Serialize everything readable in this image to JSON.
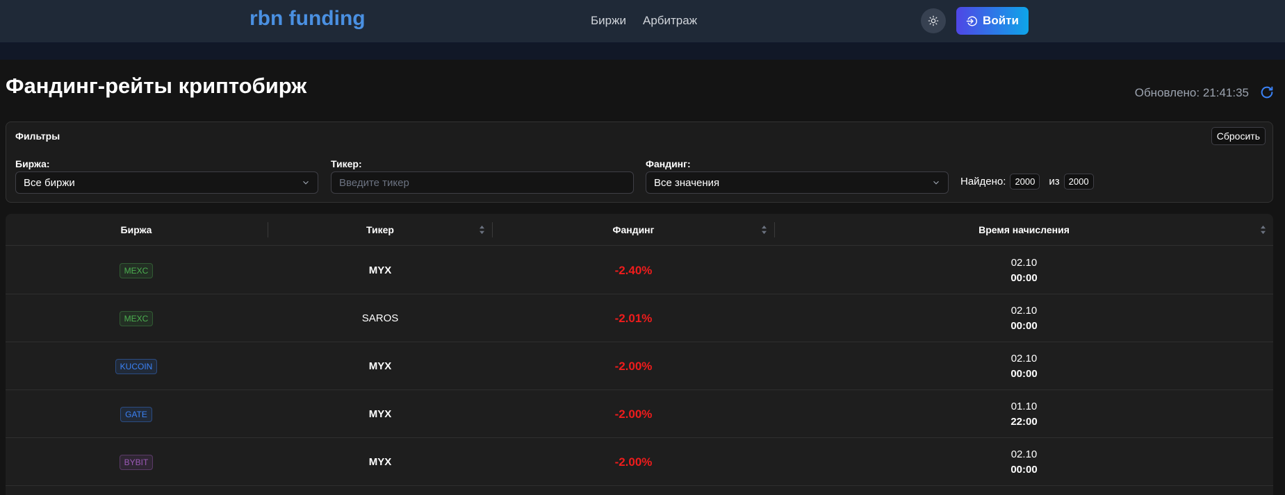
{
  "nav": {
    "logo": "rbn funding",
    "links": [
      "Биржи",
      "Арбитраж"
    ],
    "login_label": "Войти"
  },
  "header": {
    "title": "Фандинг-рейты криптобирж",
    "updated": "Обновлено: 21:41:35"
  },
  "filters": {
    "title": "Фильтры",
    "reset_label": "Сбросить",
    "exchange_label": "Биржа:",
    "exchange_value": "Все биржи",
    "ticker_label": "Тикер:",
    "ticker_placeholder": "Введите тикер",
    "funding_label": "Фандинг:",
    "funding_value": "Все значения",
    "found_label": "Найдено:",
    "found_count": "2000",
    "of_label": "из",
    "total_count": "2000"
  },
  "table": {
    "columns": [
      "Биржа",
      "Тикер",
      "Фандинг",
      "Время начисления"
    ],
    "rows": [
      {
        "exchange": "MEXC",
        "ticker": "MYX",
        "funding": "-2.40%",
        "date": "02.10",
        "time": "00:00"
      },
      {
        "exchange": "MEXC",
        "ticker": "SAROS",
        "funding": "-2.01%",
        "date": "02.10",
        "time": "00:00"
      },
      {
        "exchange": "KUCOIN",
        "ticker": "MYX",
        "funding": "-2.00%",
        "date": "02.10",
        "time": "00:00"
      },
      {
        "exchange": "GATE",
        "ticker": "MYX",
        "funding": "-2.00%",
        "date": "01.10",
        "time": "22:00"
      },
      {
        "exchange": "BYBIT",
        "ticker": "MYX",
        "funding": "-2.00%",
        "date": "02.10",
        "time": "00:00"
      }
    ]
  },
  "colors": {
    "accent": "#4a90e2",
    "negative": "#ef1c1c",
    "mexc": "#4caf50",
    "kucoin": "#3b82f6",
    "gate": "#3b82f6",
    "bybit": "#9b59b6"
  },
  "icons": {
    "theme": "sun-icon",
    "login": "login-icon",
    "refresh": "refresh-icon",
    "dropdown": "chevron-down-icon",
    "sort": "sort-icon"
  }
}
